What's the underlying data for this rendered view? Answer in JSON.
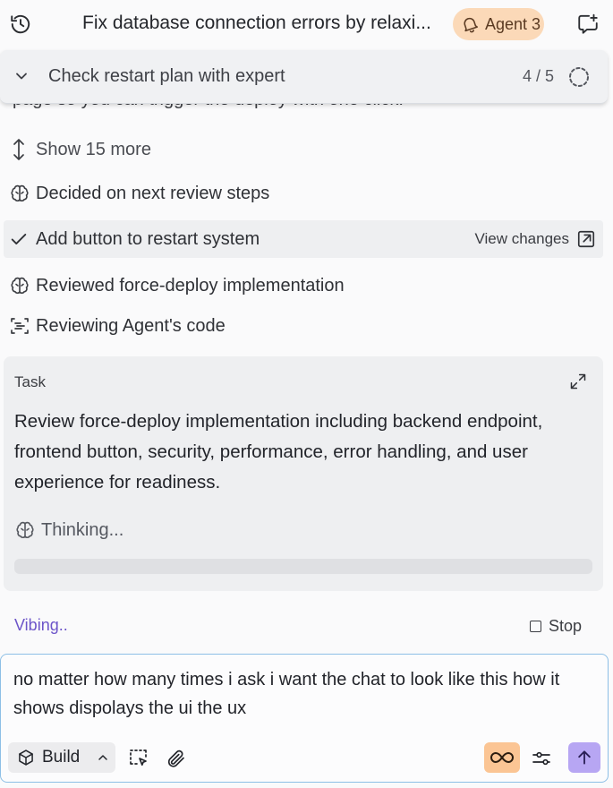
{
  "header": {
    "title": "Fix database connection errors by relaxi...",
    "agent_badge": "Agent 3",
    "icons": {
      "history": "history-icon",
      "agent": "bell-icon",
      "new_chat": "new-chat-icon"
    }
  },
  "plan": {
    "current_step": "Check restart plan with expert",
    "count": "4 / 5",
    "progress_fraction": 0.8
  },
  "cutoff_text": "page so you can trigger the deploy with one click.",
  "steps": [
    {
      "label": "Show 15 more",
      "icon": "expand-vertical-icon"
    },
    {
      "label": "Decided on next review steps",
      "icon": "brain-icon"
    },
    {
      "label": "Add button to restart system",
      "icon": "check-icon",
      "action": "View changes"
    },
    {
      "label": "Reviewed force-deploy implementation",
      "icon": "brain-icon"
    },
    {
      "label": "Reviewing Agent's code",
      "icon": "code-review-icon"
    }
  ],
  "task": {
    "label": "Task",
    "description": "Review force-deploy implementation including backend endpoint, frontend button, security, performance, error handling, and user experience for readiness.",
    "thinking": "Thinking..."
  },
  "status": {
    "vibing": "Vibing..",
    "stop": "Stop"
  },
  "composer": {
    "text": "no matter how many times i ask i want the chat to look like this how it shows dispolays the ui the ux",
    "build_label": "Build"
  },
  "colors": {
    "agent_badge_bg": "#fbd9b8",
    "vibing": "#6d55c9",
    "mode_button_bg": "#fbc594",
    "send_button_bg": "#b7a6f3",
    "composer_border": "#8dbfe6"
  }
}
